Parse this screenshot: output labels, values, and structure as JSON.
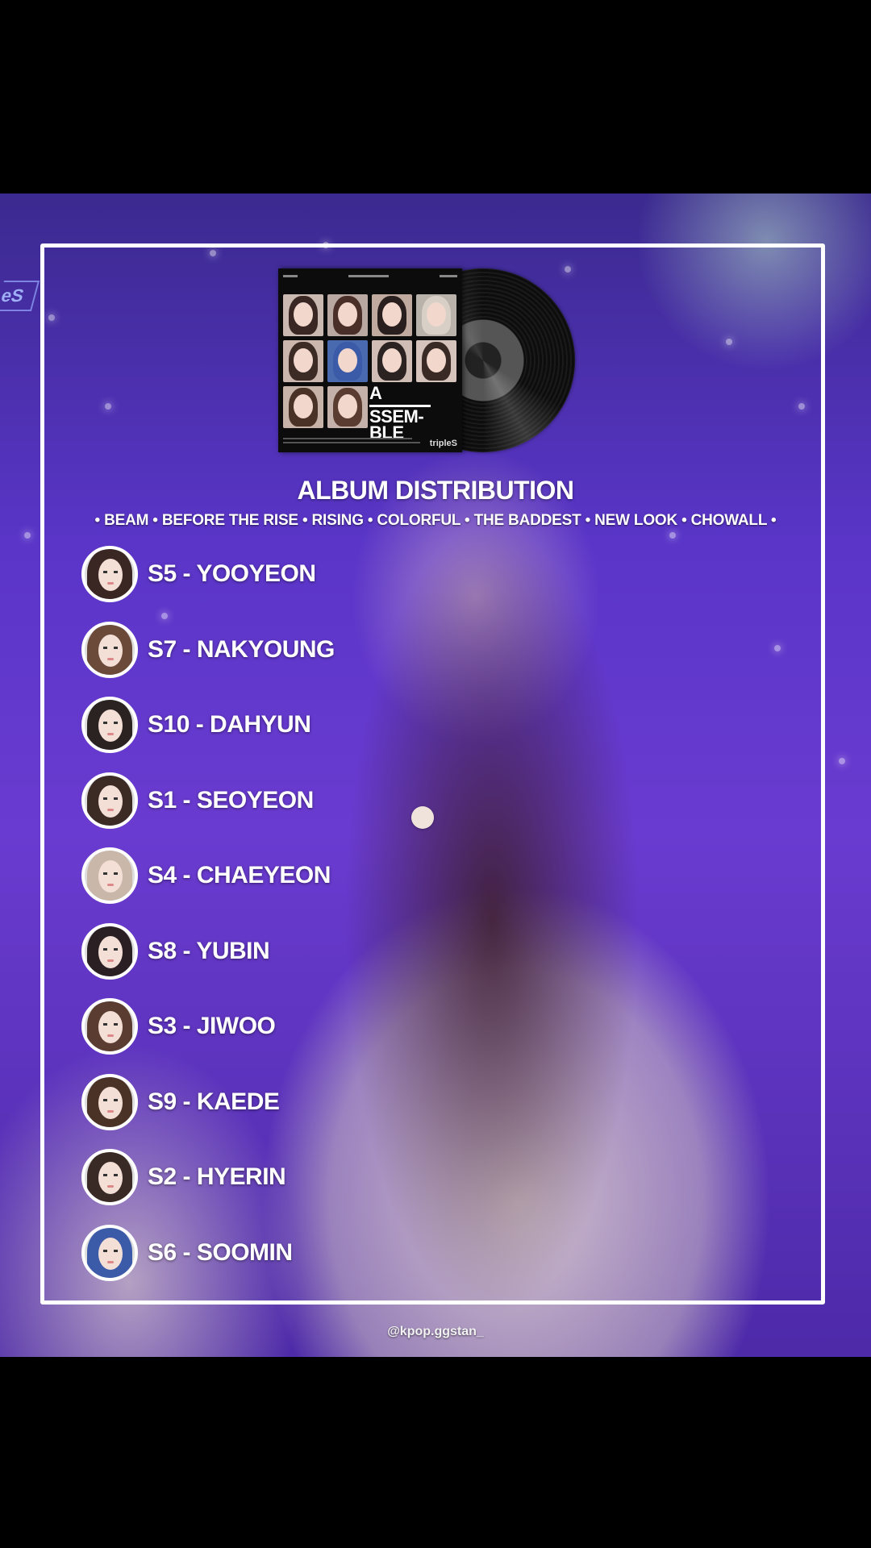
{
  "broadcast_logo": "eS",
  "album": {
    "title_line1": "A",
    "title_line2": "SSEM-",
    "title_line3": "BLE",
    "brand": "tripleS"
  },
  "heading": "ALBUM DISTRIBUTION",
  "subheading": "• BEAM • BEFORE THE RISE • RISING • COLORFUL • THE BADDEST • NEW LOOK • CHOWALL •",
  "members": [
    {
      "label": "S5 - YOOYEON",
      "hair": "#3a2622"
    },
    {
      "label": "S7 - NAKYOUNG",
      "hair": "#6b4a3a"
    },
    {
      "label": "S10 - DAHYUN",
      "hair": "#2b2222"
    },
    {
      "label": "S1 - SEOYEON",
      "hair": "#3c2a25"
    },
    {
      "label": "S4 - CHAEYEON",
      "hair": "#c9b7aa"
    },
    {
      "label": "S8 - YUBIN",
      "hair": "#2a1f22"
    },
    {
      "label": "S3 - JIWOO",
      "hair": "#5a3c30"
    },
    {
      "label": "S9 - KAEDE",
      "hair": "#4a3226"
    },
    {
      "label": "S2 - HYERIN",
      "hair": "#3a2a26"
    },
    {
      "label": "S6 - SOOMIN",
      "hair": "#3b5aa8"
    }
  ],
  "watermark": "@kpop.ggstan_",
  "colors": {
    "frame": "#ffffff",
    "background_purple": "#5a35c8"
  }
}
